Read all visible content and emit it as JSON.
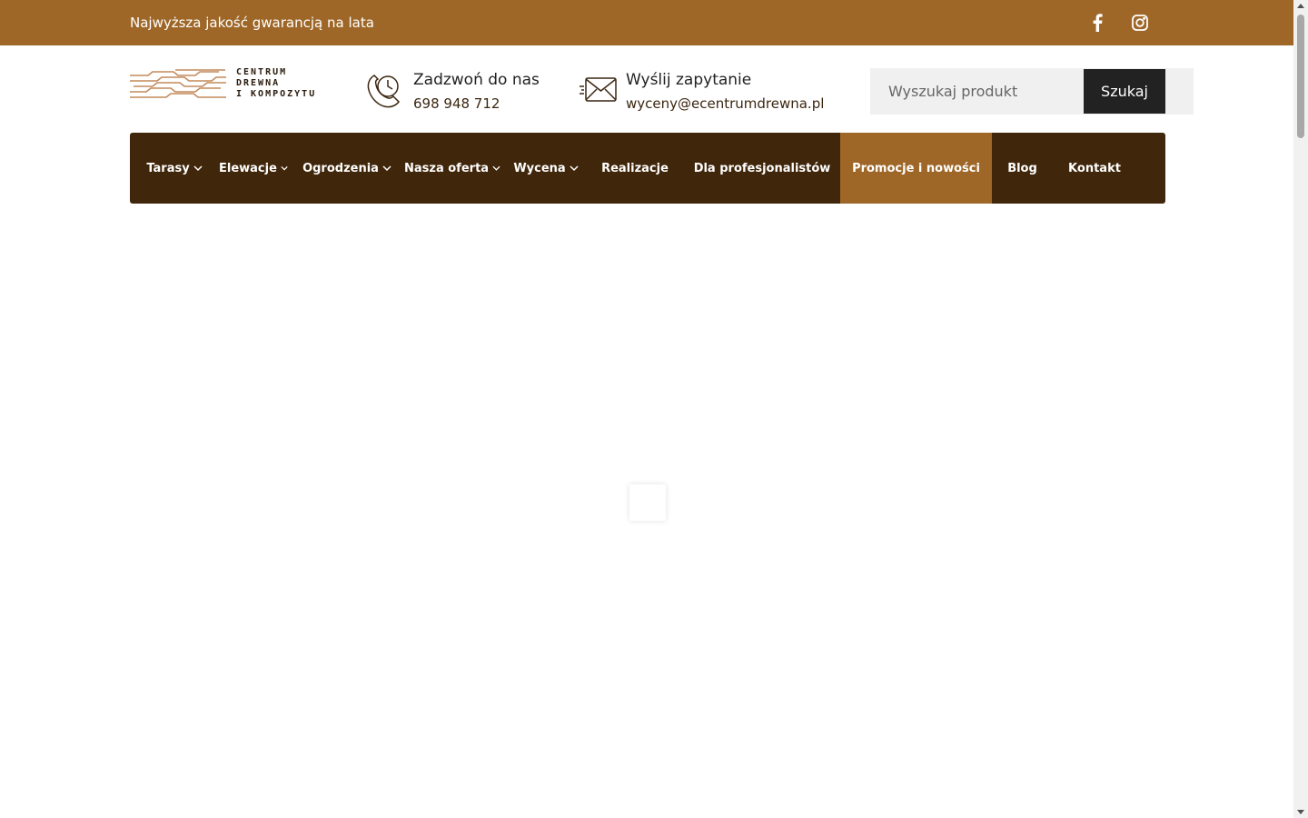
{
  "colors": {
    "topbar": "#9e6728",
    "nav": "#40260a",
    "nav_active": "#9e6728",
    "search_button": "#222222"
  },
  "topbar": {
    "tagline": "Najwyższa jakość gwarancją na lata",
    "social": [
      "facebook-icon",
      "instagram-icon"
    ]
  },
  "logo": {
    "line1": "CENTRUM",
    "line2": "DREWNA",
    "line3": "I KOMPOZYTU"
  },
  "contact": {
    "phone": {
      "icon": "phone-clock-icon",
      "title": "Zadzwoń do nas",
      "value": "698 948 712"
    },
    "email": {
      "icon": "envelope-icon",
      "title": "Wyślij zapytanie",
      "value": "wyceny@ecentrumdrewna.pl"
    }
  },
  "search": {
    "placeholder": "Wyszukaj produkt",
    "button": "Szukaj"
  },
  "nav": {
    "items": [
      {
        "label": "Tarasy",
        "dropdown": true
      },
      {
        "label": "Elewacje",
        "dropdown": true
      },
      {
        "label": "Ogrodzenia",
        "dropdown": true
      },
      {
        "label": "Nasza oferta",
        "dropdown": true
      },
      {
        "label": "Wycena",
        "dropdown": true
      },
      {
        "label": "Realizacje",
        "dropdown": false
      },
      {
        "label": "Dla profesjonalistów",
        "dropdown": false
      },
      {
        "label": "Promocje i nowości",
        "dropdown": false,
        "active": true
      },
      {
        "label": "Blog",
        "dropdown": false
      },
      {
        "label": "Kontakt",
        "dropdown": false
      }
    ]
  }
}
